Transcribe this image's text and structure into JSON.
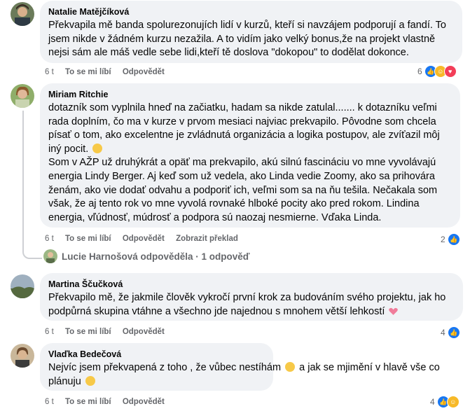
{
  "comments": [
    {
      "author": "Natalie Matějčíková",
      "lines": [
        "Překvapila mě banda spolurezonujích lidí v kurzů, kteří si navzájem podporují a fandí. To",
        "jsem nikde v žádném kurzu nezažila. A to vidím jako velký bonus,že na projekt vlastně",
        "nejsi sám ale máš vedle sebe lidi,kteří tě doslova \"dokopou\" to dodělat dokonce."
      ],
      "time": "6 t",
      "like": "To se mi líbí",
      "reply": "Odpovědět",
      "reaction_count": "6",
      "reactions": [
        "like-icon",
        "care-icon",
        "love-icon"
      ]
    },
    {
      "author": "Miriam Ritchie",
      "lines": [
        "dotazník som vyplnila hneď na začiatku, hadam sa nikde zatulal....... k dotazníku veľmi",
        "rada doplním, čo ma v kurze v prvom mesiaci najviac prekvapilo. Pôvodne som chcela",
        "písať o tom, ako excelentne je zvládnutá organizácia a logika postupov, ale zvíťazil môj",
        "iný pocit.",
        "Som v AŽP už druhýkrát a opäť ma prekvapilo, akú silnú fascináciu vo mne vyvolávajú",
        "energia Lindy Berger. Aj keď som už vedela, ako Linda vedie Zoomy, ako sa prihovára",
        "ženám, ako vie dodať odvahu a podporiť ich, veľmi som sa na ňu tešila. Nečakala som",
        "však, že aj tento rok vo mne vyvolá rovnaké hlboké pocity ako pred rokom. Lindina",
        "energia, vľúdnosť, múdrosť a podpora sú naozaj nesmierne. Vďaka Linda."
      ],
      "time": "6 t",
      "like": "To se mi líbí",
      "reply": "Odpovědět",
      "translate": "Zobrazit překlad",
      "reaction_count": "2",
      "reactions": [
        "like-icon"
      ],
      "reply_summary": "Lucie Harnošová odpověděla · 1 odpověď"
    },
    {
      "author": "Martina Ščučková",
      "lines": [
        "Překvapilo mě, že jakmile člověk vykročí první krok za budováním svého projektu, jak ho",
        "podpůrná skupina vtáhne a všechno jde najednou s mnohem větší lehkostí"
      ],
      "time": "6 t",
      "like": "To se mi líbí",
      "reply": "Odpovědět",
      "reaction_count": "4",
      "reactions": [
        "like-icon"
      ]
    },
    {
      "author": "Vlaďka Bedečová",
      "lines": [
        "Nejvíc jsem překvapená z toho , že vůbec nestíhám",
        "a jak se mjimění v hlavě vše co",
        "plánuju"
      ],
      "time": "6 t",
      "like": "To se mi líbí",
      "reply": "Odpovědět",
      "reaction_count": "4",
      "reactions": [
        "like-icon",
        "care-icon"
      ]
    }
  ]
}
